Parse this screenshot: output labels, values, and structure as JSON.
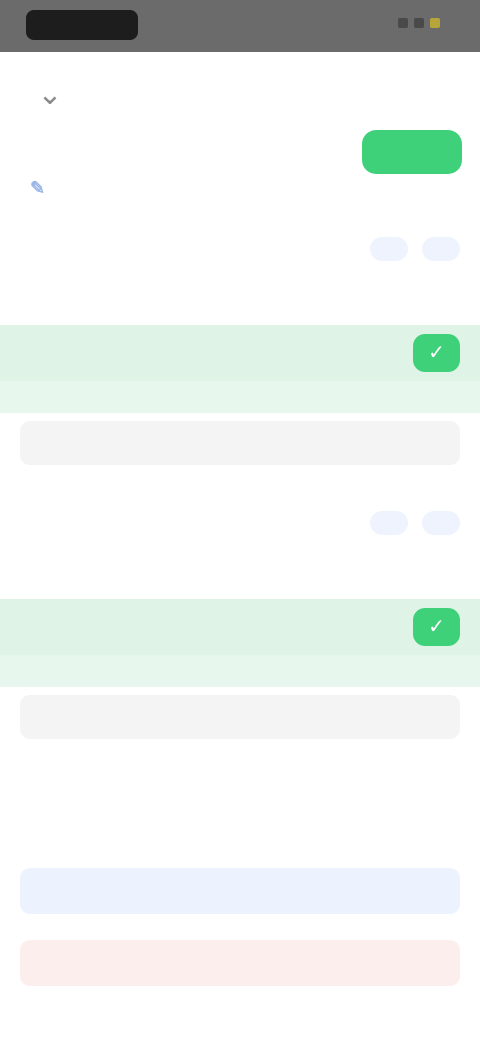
{
  "status_bar": {
    "time": "",
    "icons": [
      "signal-icon",
      "wifi-icon",
      "battery-icon"
    ]
  },
  "top_bar": {
    "back_icon": "chevron-down-icon",
    "save_label": ""
  },
  "workout": {
    "title": "",
    "subtitle": "",
    "meta": "",
    "edit_icon": "pencil-icon"
  },
  "table_header": {
    "set": "",
    "previous": "",
    "kg": "",
    "reps": "",
    "check": ""
  },
  "exercises": [
    {
      "name": "",
      "actions": [
        "",
        ""
      ],
      "sets": [
        {
          "set": "",
          "previous": "",
          "kg": "",
          "reps": "",
          "done": true
        }
      ],
      "rest_timer": "",
      "add_set_label": ""
    },
    {
      "name": "",
      "actions": [
        "",
        ""
      ],
      "sets": [
        {
          "set": "",
          "previous": "",
          "kg": "",
          "reps": "",
          "done": true
        }
      ],
      "rest_timer": "",
      "add_set_label": ""
    }
  ],
  "buttons": {
    "add_exercise": "",
    "cancel_workout": ""
  },
  "colors": {
    "accent_green": "#3fd07a",
    "accent_blue": "#4b86e6",
    "danger_red": "#e74a4a",
    "completed_row": "#dff3e6"
  }
}
